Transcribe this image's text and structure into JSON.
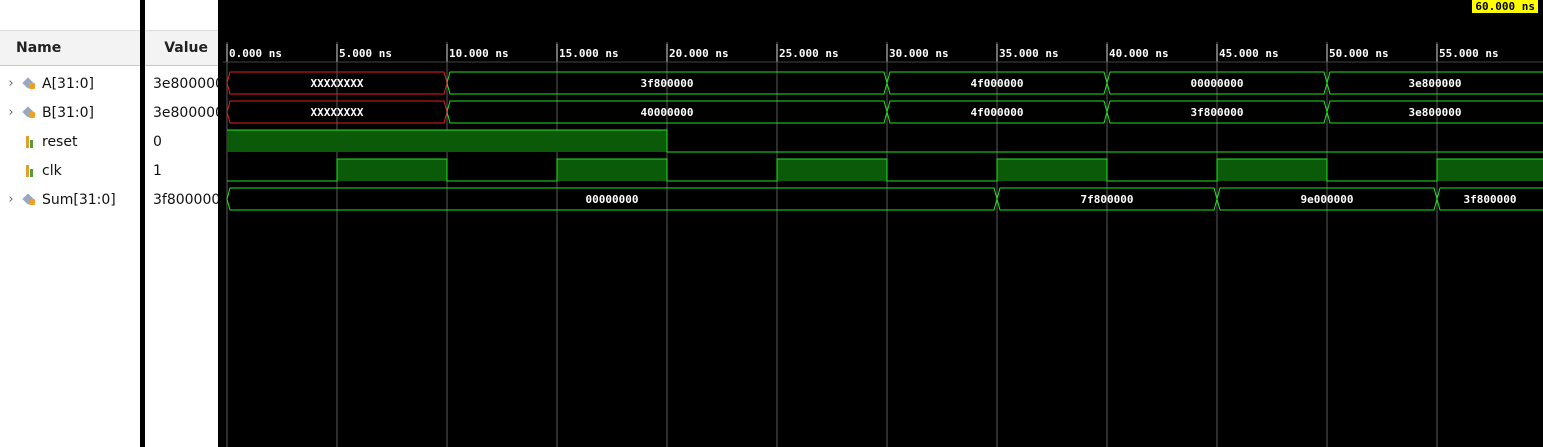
{
  "cursor_time": "60.000 ns",
  "headers": {
    "name": "Name",
    "value": "Value"
  },
  "colors": {
    "wave": "#1ee51e",
    "fill": "#0a5a0a",
    "unknown": "#e02020",
    "cursor_bg": "#ffff00",
    "grid": "#5a5a5a"
  },
  "timescale": {
    "ticks": [
      "0.000 ns",
      "5.000 ns",
      "10.000 ns",
      "15.000 ns",
      "20.000 ns",
      "25.000 ns",
      "30.000 ns",
      "35.000 ns",
      "40.000 ns",
      "45.000 ns",
      "50.000 ns",
      "55.000 ns"
    ]
  },
  "signals": [
    {
      "name": "A[31:0]",
      "value": "3e800000",
      "kind": "bus",
      "expandable": true,
      "icon": "bus-icon",
      "segments": [
        {
          "start": 0,
          "end": 10,
          "label": "XXXXXXXX",
          "unknown": true
        },
        {
          "start": 10,
          "end": 30,
          "label": "3f800000"
        },
        {
          "start": 30,
          "end": 40,
          "label": "4f000000"
        },
        {
          "start": 40,
          "end": 50,
          "label": "00000000"
        },
        {
          "start": 50,
          "end": 60,
          "label": "3e800000"
        }
      ]
    },
    {
      "name": "B[31:0]",
      "value": "3e800000",
      "kind": "bus",
      "expandable": true,
      "icon": "bus-icon",
      "segments": [
        {
          "start": 0,
          "end": 10,
          "label": "XXXXXXXX",
          "unknown": true
        },
        {
          "start": 10,
          "end": 30,
          "label": "40000000"
        },
        {
          "start": 30,
          "end": 40,
          "label": "4f000000"
        },
        {
          "start": 40,
          "end": 50,
          "label": "3f800000"
        },
        {
          "start": 50,
          "end": 60,
          "label": "3e800000"
        }
      ]
    },
    {
      "name": "reset",
      "value": "0",
      "kind": "bit",
      "expandable": false,
      "icon": "bit-icon",
      "transitions": [
        [
          0,
          1
        ],
        [
          20,
          0
        ]
      ]
    },
    {
      "name": "clk",
      "value": "1",
      "kind": "bit",
      "expandable": false,
      "icon": "bit-icon",
      "transitions": [
        [
          0,
          0
        ],
        [
          5,
          1
        ],
        [
          10,
          0
        ],
        [
          15,
          1
        ],
        [
          20,
          0
        ],
        [
          25,
          1
        ],
        [
          30,
          0
        ],
        [
          35,
          1
        ],
        [
          40,
          0
        ],
        [
          45,
          1
        ],
        [
          50,
          0
        ],
        [
          55,
          1
        ]
      ]
    },
    {
      "name": "Sum[31:0]",
      "value": "3f800000",
      "kind": "bus",
      "expandable": true,
      "icon": "bus-icon",
      "segments": [
        {
          "start": 0,
          "end": 35,
          "label": "00000000"
        },
        {
          "start": 35,
          "end": 45,
          "label": "7f800000"
        },
        {
          "start": 45,
          "end": 55,
          "label": "9e000000"
        },
        {
          "start": 55,
          "end": 60,
          "label": "3f800000"
        }
      ]
    }
  ]
}
